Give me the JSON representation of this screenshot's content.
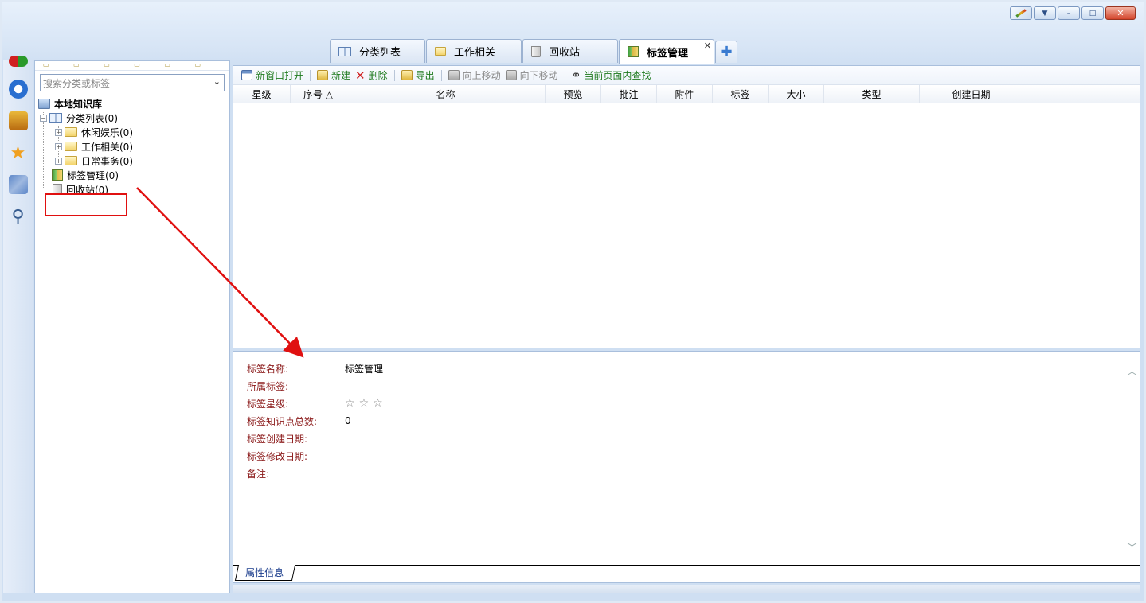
{
  "window": {
    "controls": [
      "",
      "▼",
      "–",
      "□",
      "✕"
    ]
  },
  "tabs": [
    {
      "label": "分类列表",
      "icon": "book-icon"
    },
    {
      "label": "工作相关",
      "icon": "folder-icon"
    },
    {
      "label": "回收站",
      "icon": "trash-icon"
    },
    {
      "label": "标签管理",
      "icon": "tag-book-icon",
      "active": true
    }
  ],
  "tab_close": "✕",
  "tab_add": "✚",
  "sidebar": {
    "tools_row": "▭ ▭ ▭ ▭ ▭ ▭ ▭",
    "search_placeholder": "搜索分类或标签",
    "tree": {
      "root": "本地知识库",
      "category": "分类列表(0)",
      "children": [
        "休闲娱乐(0)",
        "工作相关(0)",
        "日常事务(0)"
      ],
      "tags": "标签管理(0)",
      "trash": "回收站(0)"
    }
  },
  "toolbar": {
    "open_new_window": "新窗口打开",
    "new": "新建",
    "delete": "删除",
    "export": "导出",
    "move_up": "向上移动",
    "move_down": "向下移动",
    "find_in_page": "当前页面内查找"
  },
  "grid": {
    "columns": [
      "星级",
      "序号 △",
      "名称",
      "预览",
      "批注",
      "附件",
      "标签",
      "大小",
      "类型",
      "创建日期"
    ]
  },
  "properties": {
    "name_label": "标签名称:",
    "name_value": "标签管理",
    "parent_label": "所属标签:",
    "parent_value": "",
    "rating_label": "标签星级:",
    "rating_value": 0,
    "rating_max": 3,
    "count_label": "标签知识点总数:",
    "count_value": "0",
    "created_label": "标签创建日期:",
    "created_value": "",
    "modified_label": "标签修改日期:",
    "modified_value": "",
    "note_label": "备注:",
    "note_value": ""
  },
  "bottom_tab": "属性信息",
  "colors": {
    "accent_green": "#1e7a1e",
    "label_red": "#8b1a1a",
    "highlight_red": "#e01010"
  }
}
